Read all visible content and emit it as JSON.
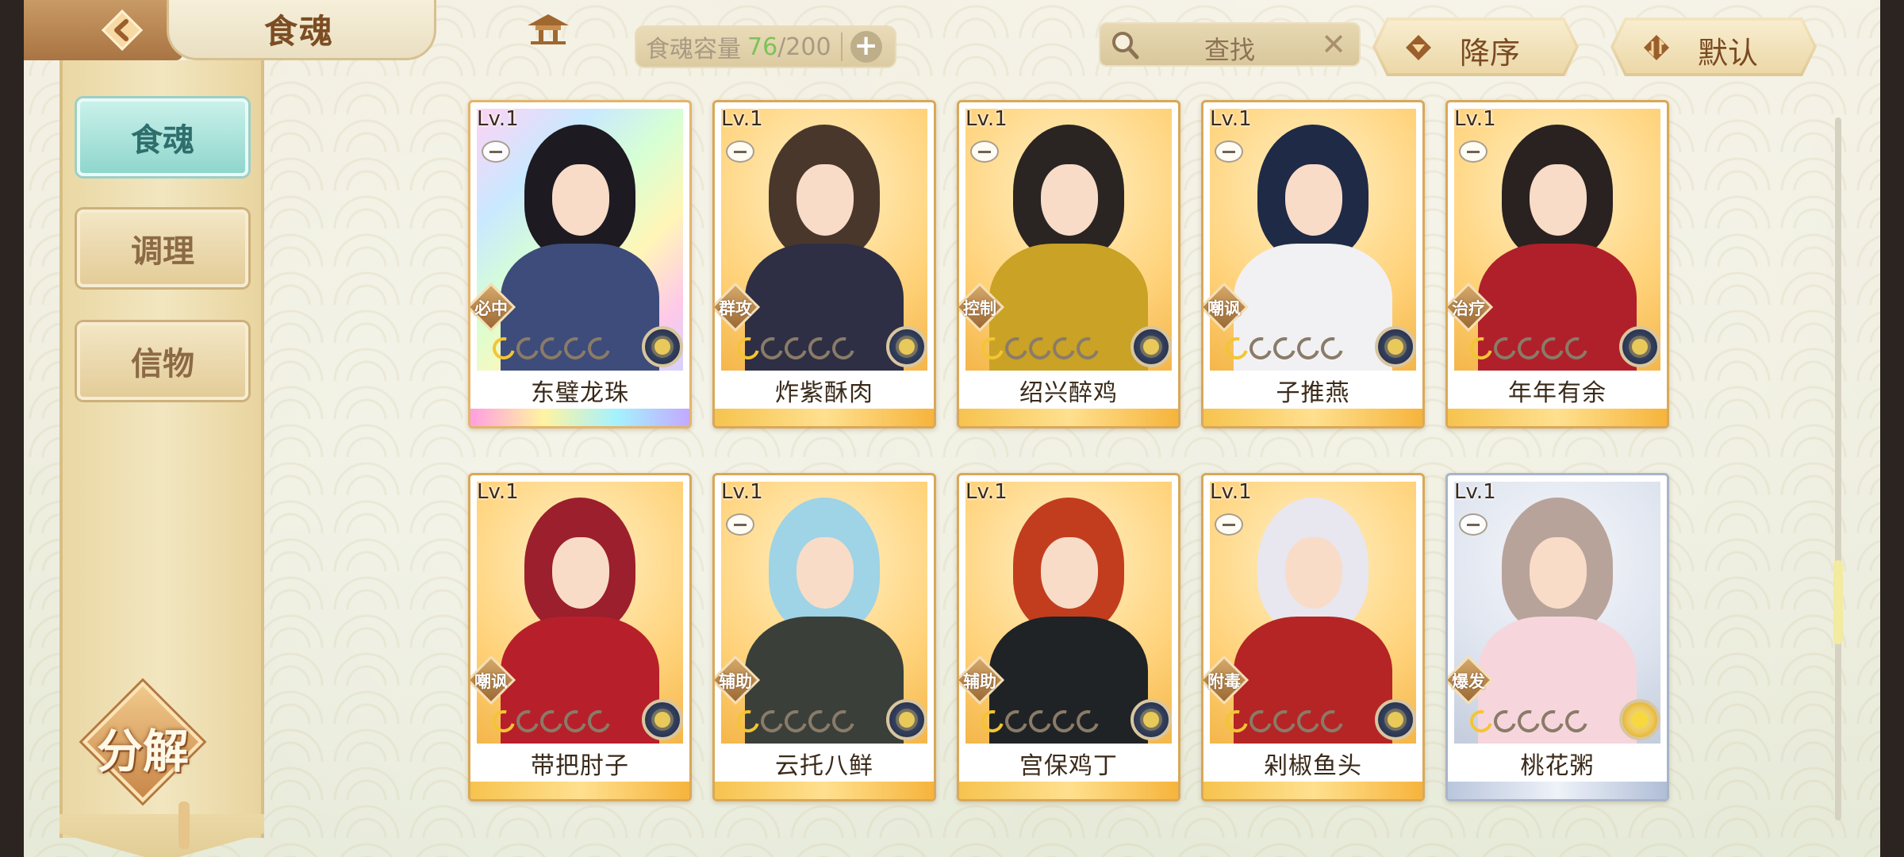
{
  "header": {
    "title": "食魂",
    "back_icon": "back-arrow-icon",
    "home_icon": "pavilion-icon"
  },
  "capacity": {
    "label": "食魂容量",
    "current": "76",
    "separator": "/",
    "max": "200",
    "plus_label": "+"
  },
  "search": {
    "placeholder": "查找",
    "clear_label": "✕"
  },
  "sort": {
    "order_label": "降序",
    "filter_label": "默认"
  },
  "sidebar": {
    "items": [
      {
        "label": "食魂",
        "active": true
      },
      {
        "label": "调理",
        "active": false
      },
      {
        "label": "信物",
        "active": false
      }
    ],
    "decompose_label": "分解"
  },
  "cards": [
    {
      "level": "Lv.1",
      "name": "东璧龙珠",
      "role": "必中",
      "frame": "rainbow",
      "gold_stars": 1,
      "element": "dark"
    },
    {
      "level": "Lv.1",
      "name": "炸紫酥肉",
      "role": "群攻",
      "frame": "gold",
      "gold_stars": 1,
      "element": "dark"
    },
    {
      "level": "Lv.1",
      "name": "绍兴醉鸡",
      "role": "控制",
      "frame": "gold",
      "gold_stars": 1,
      "element": "dark"
    },
    {
      "level": "Lv.1",
      "name": "子推燕",
      "role": "嘲讽",
      "frame": "gold",
      "gold_stars": 1,
      "element": "dark"
    },
    {
      "level": "Lv.1",
      "name": "年年有余",
      "role": "治疗",
      "frame": "gold",
      "gold_stars": 1,
      "element": "dark"
    },
    {
      "level": "Lv.1",
      "name": "带把肘子",
      "role": "嘲讽",
      "frame": "gold",
      "gold_stars": 1,
      "element": "dark"
    },
    {
      "level": "Lv.1",
      "name": "云托八鲜",
      "role": "辅助",
      "frame": "gold",
      "gold_stars": 1,
      "element": "dark"
    },
    {
      "level": "Lv.1",
      "name": "宫保鸡丁",
      "role": "辅助",
      "frame": "gold",
      "gold_stars": 1,
      "element": "dark"
    },
    {
      "level": "Lv.1",
      "name": "剁椒鱼头",
      "role": "附毒",
      "frame": "gold",
      "gold_stars": 1,
      "element": "dark"
    },
    {
      "level": "Lv.1",
      "name": "桃花粥",
      "role": "爆发",
      "frame": "silver",
      "gold_stars": 1,
      "element": "gold"
    }
  ],
  "colors": {
    "capacity_current": "#7ac35a",
    "active_tab": "#8fd6cd",
    "card_gold": "#ffd27a"
  }
}
